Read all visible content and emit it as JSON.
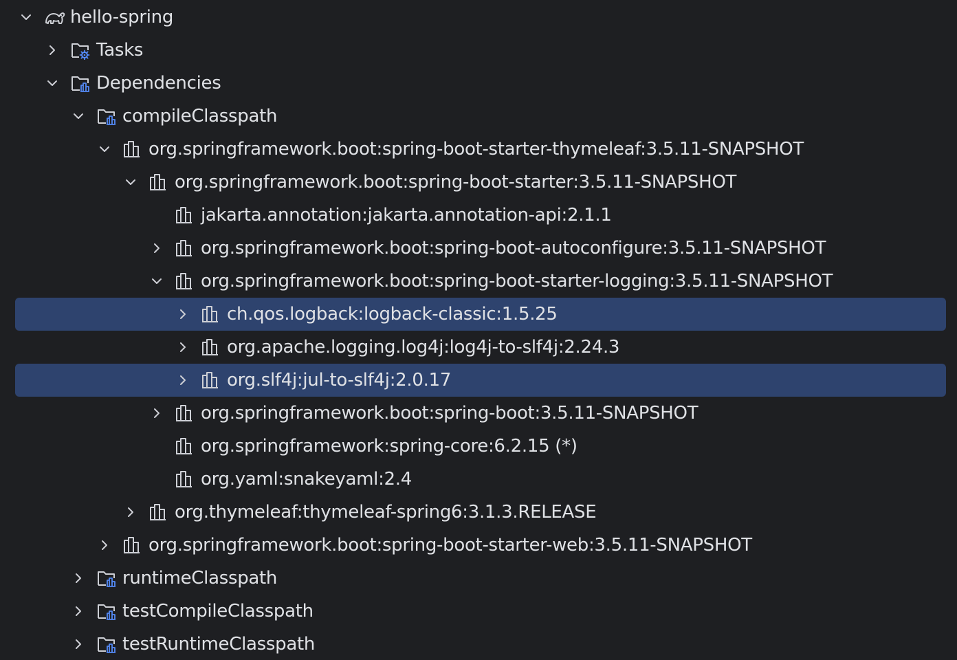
{
  "tree": {
    "rows": [
      {
        "depth": 0,
        "expander": "expanded",
        "icon": "gradle-project-icon",
        "label": "hello-spring",
        "selected": false
      },
      {
        "depth": 1,
        "expander": "collapsed",
        "icon": "tasks-folder-icon",
        "label": "Tasks",
        "selected": false
      },
      {
        "depth": 1,
        "expander": "expanded",
        "icon": "dependencies-folder-icon",
        "label": "Dependencies",
        "selected": false
      },
      {
        "depth": 2,
        "expander": "expanded",
        "icon": "dependencies-folder-icon",
        "label": "compileClasspath",
        "selected": false
      },
      {
        "depth": 3,
        "expander": "expanded",
        "icon": "library-icon",
        "label": "org.springframework.boot:spring-boot-starter-thymeleaf:3.5.11-SNAPSHOT",
        "selected": false
      },
      {
        "depth": 4,
        "expander": "expanded",
        "icon": "library-icon",
        "label": "org.springframework.boot:spring-boot-starter:3.5.11-SNAPSHOT",
        "selected": false
      },
      {
        "depth": 5,
        "expander": "none",
        "icon": "library-icon",
        "label": "jakarta.annotation:jakarta.annotation-api:2.1.1",
        "selected": false
      },
      {
        "depth": 5,
        "expander": "collapsed",
        "icon": "library-icon",
        "label": "org.springframework.boot:spring-boot-autoconfigure:3.5.11-SNAPSHOT",
        "selected": false
      },
      {
        "depth": 5,
        "expander": "expanded",
        "icon": "library-icon",
        "label": "org.springframework.boot:spring-boot-starter-logging:3.5.11-SNAPSHOT",
        "selected": false
      },
      {
        "depth": 6,
        "expander": "collapsed",
        "icon": "library-icon",
        "label": "ch.qos.logback:logback-classic:1.5.25",
        "selected": true
      },
      {
        "depth": 6,
        "expander": "collapsed",
        "icon": "library-icon",
        "label": "org.apache.logging.log4j:log4j-to-slf4j:2.24.3",
        "selected": false
      },
      {
        "depth": 6,
        "expander": "collapsed",
        "icon": "library-icon",
        "label": "org.slf4j:jul-to-slf4j:2.0.17",
        "selected": true
      },
      {
        "depth": 5,
        "expander": "collapsed",
        "icon": "library-icon",
        "label": "org.springframework.boot:spring-boot:3.5.11-SNAPSHOT",
        "selected": false
      },
      {
        "depth": 5,
        "expander": "none",
        "icon": "library-icon",
        "label": "org.springframework:spring-core:6.2.15 (*)",
        "selected": false
      },
      {
        "depth": 5,
        "expander": "none",
        "icon": "library-icon",
        "label": "org.yaml:snakeyaml:2.4",
        "selected": false
      },
      {
        "depth": 4,
        "expander": "collapsed",
        "icon": "library-icon",
        "label": "org.thymeleaf:thymeleaf-spring6:3.1.3.RELEASE",
        "selected": false
      },
      {
        "depth": 3,
        "expander": "collapsed",
        "icon": "library-icon",
        "label": "org.springframework.boot:spring-boot-starter-web:3.5.11-SNAPSHOT",
        "selected": false
      },
      {
        "depth": 2,
        "expander": "collapsed",
        "icon": "dependencies-folder-icon",
        "label": "runtimeClasspath",
        "selected": false
      },
      {
        "depth": 2,
        "expander": "collapsed",
        "icon": "dependencies-folder-icon",
        "label": "testCompileClasspath",
        "selected": false
      },
      {
        "depth": 2,
        "expander": "collapsed",
        "icon": "dependencies-folder-icon",
        "label": "testRuntimeClasspath",
        "selected": false
      }
    ]
  },
  "colors": {
    "background": "#1e1f22",
    "text": "#dfe1e5",
    "selection": "#2e436e",
    "icon_stroke": "#ced0d6",
    "icon_accent": "#548af7"
  }
}
